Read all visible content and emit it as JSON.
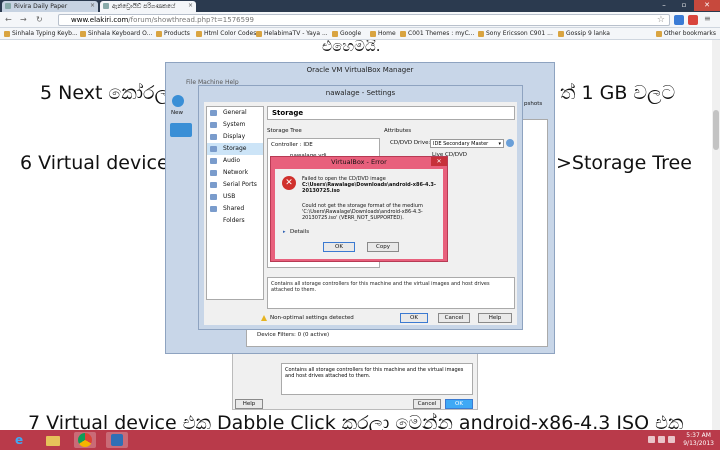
{
  "browser": {
    "tabs": [
      {
        "label": "Rivira Daily Paper",
        "active": false
      },
      {
        "label": "ඇන්ඩ්‍රොයිඩ් පරිගණකයේ",
        "active": true
      }
    ],
    "url_domain": "www.elakiri.com",
    "url_path": "/forum/showthread.php?t=1576599",
    "bookmarks": [
      "Sinhala Typing Keyb...",
      "Sinhala Keyboard O...",
      "Products",
      "Html Color Codes",
      "HelabimaTV - Yaya ...",
      "Google",
      "Home",
      "C001 Themes : myC...",
      "Sony Ericsson C901 ...",
      "Gossip 9 lanka"
    ],
    "other_bookmarks": "Other bookmarks"
  },
  "page": {
    "line_top": "එහෙමයි.",
    "line5_start": "5 Next කෝරල",
    "line5_end": "ත් 1 GB වලට",
    "line6_start": "6 Virtual device",
    "line6_end": ">Storage Tree",
    "line7": "7 Virtual device එක Dabble Click කරලා මෙන්න android-x86-4.3 ISO එක"
  },
  "manager": {
    "title": "Oracle VM VirtualBox Manager",
    "menu": "File   Machine   Help",
    "new_label": "New",
    "set_label": "Setti",
    "snapshots": "pshots",
    "lower_info": "Contains all storage controllers for this machine and the virtual images and host drives attached to them.",
    "device_filters": "Device Filters:   0 (0 active)",
    "help": "Help",
    "cancel": "Cancel",
    "ok": "OK"
  },
  "settings": {
    "title": "nawalage - Settings",
    "categories": [
      "General",
      "System",
      "Display",
      "Storage",
      "Audio",
      "Network",
      "Serial Ports",
      "USB",
      "Shared Folders"
    ],
    "selected": "Storage",
    "section": "Storage",
    "storage_tree_label": "Storage Tree",
    "attributes_label": "Attributes",
    "controller": "Controller : IDE",
    "disk": "nawalage.vdi",
    "cd_drive_label": "CD/DVD Drive:",
    "cd_drive_value": "IDE Secondary Master",
    "live_cd": "Live CD/DVD",
    "info_text": "Contains all storage controllers for this machine and the virtual images and host drives attached to them.",
    "warning": "Non-optimal settings detected",
    "ok": "OK",
    "cancel": "Cancel",
    "help": "Help"
  },
  "error": {
    "title": "VirtualBox - Error",
    "msg1_prefix": "Failed to open the CD/DVD image ",
    "msg1_path": "C:\\Users\\Rawalage\\Downloads\\android-x86-4.3-20130725.iso",
    "msg2": "Could not get the storage format of the medium 'C:\\Users\\Rawalage\\Downloads\\android-x86-4.3-20130725.iso' (VERR_NOT_SUPPORTED).",
    "details": "Details",
    "ok": "OK",
    "copy": "Copy"
  },
  "taskbar": {
    "time": "5:37 AM",
    "date": "9/13/2013"
  }
}
